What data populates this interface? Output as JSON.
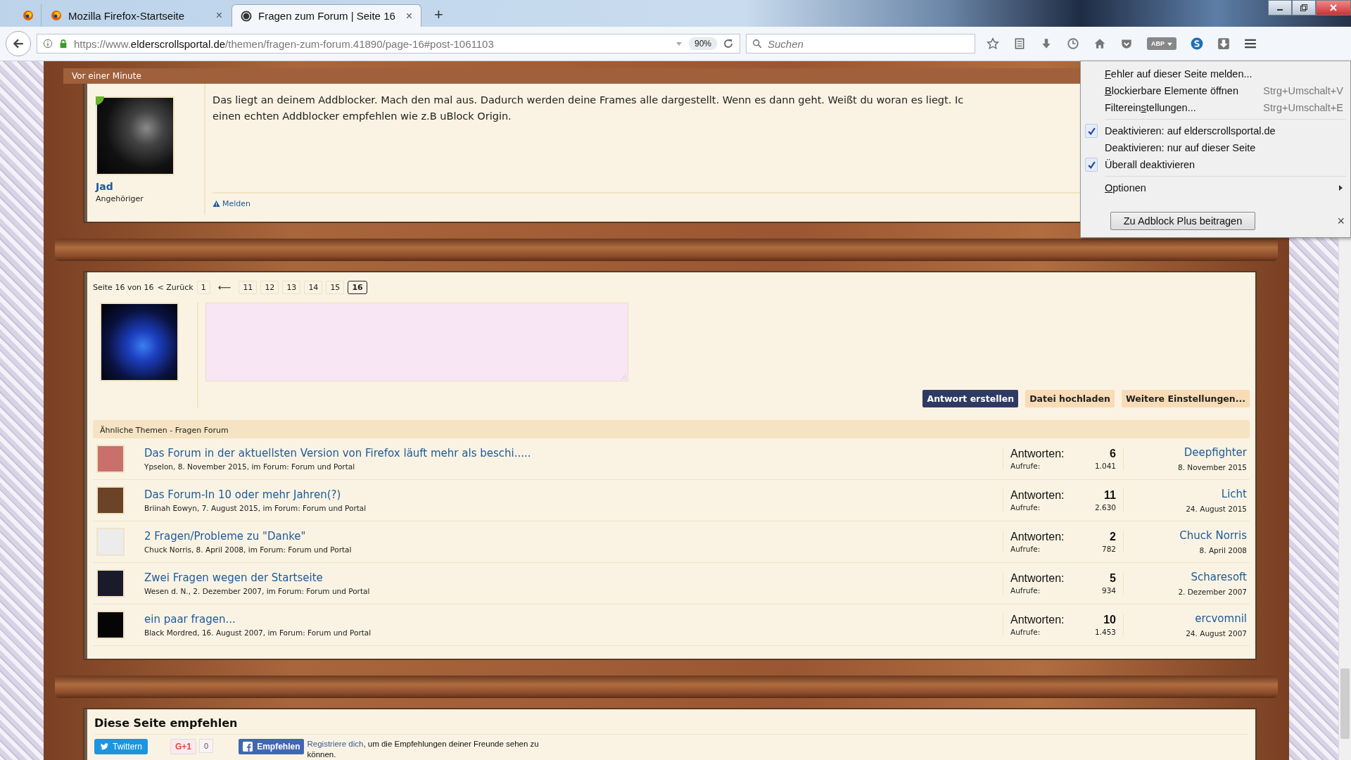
{
  "browser": {
    "pinned_tab": {
      "selected": false
    },
    "tabs": [
      {
        "title": "Mozilla Firefox-Startseite",
        "close": "×",
        "selected": false
      },
      {
        "title": "Fragen zum Forum | Seite 16",
        "close": "×",
        "selected": true
      }
    ],
    "new_tab": "+",
    "url": {
      "prefix": "https://www.",
      "domain": "elderscrollsportal.de",
      "path": "/themen/fragen-zum-forum.41890/page-16#post-1061103"
    },
    "zoom": "90%",
    "search": {
      "placeholder": "Suchen"
    },
    "adblock_badge": "ABP"
  },
  "post": {
    "time": "Vor einer Minute",
    "author": "Jad",
    "role": "Angehöriger",
    "online": true,
    "lines": [
      "Das liegt an deinem Addblocker. Mach den mal aus. Dadurch werden deine Frames alle dargestellt. Wenn es dann geht. Weißt du woran es liegt. Ic",
      "einen echten Addblocker empfehlen wie z.B uBlock Origin."
    ],
    "report": "Melden"
  },
  "pagination": {
    "label": "Seite 16 von 16",
    "prev": "< Zurück",
    "first": [
      {
        "label": "1",
        "selected": false
      }
    ],
    "skip": "⟵",
    "pages": [
      {
        "label": "11",
        "selected": false
      },
      {
        "label": "12",
        "selected": false
      },
      {
        "label": "13",
        "selected": false
      },
      {
        "label": "14",
        "selected": false
      },
      {
        "label": "15",
        "selected": false
      },
      {
        "label": "16",
        "selected": true
      }
    ]
  },
  "reply": {
    "buttons": [
      {
        "label": "Antwort erstellen",
        "kind": "primary"
      },
      {
        "label": "Datei hochladen",
        "kind": "secondary"
      },
      {
        "label": "Weitere Einstellungen...",
        "kind": "secondary"
      }
    ]
  },
  "similar": {
    "title": "Ähnliche Themen - Fragen Forum",
    "threads": [
      {
        "title": "Das Forum in der aktuellsten Version von Firefox läuft mehr als beschi.....",
        "meta": "Ypselon, 8. November 2015, im Forum: Forum und Portal",
        "replies_label": "Antworten:",
        "replies": "6",
        "views_label": "Aufrufe:",
        "views": "1.041",
        "last_user": "Deepfighter",
        "last_date": "8. November 2015",
        "color": "#c9706a"
      },
      {
        "title": "Das Forum-In 10 oder mehr Jahren(?)",
        "meta": "Briinah Eowyn, 7. August 2015, im Forum: Forum und Portal",
        "replies_label": "Antworten:",
        "replies": "11",
        "views_label": "Aufrufe:",
        "views": "2.630",
        "last_user": "Licht",
        "last_date": "24. August 2015",
        "color": "#6b4326"
      },
      {
        "title": "2 Fragen/Probleme zu \"Danke\"",
        "meta": "Chuck Norris, 8. April 2008, im Forum: Forum und Portal",
        "replies_label": "Antworten:",
        "replies": "2",
        "views_label": "Aufrufe:",
        "views": "782",
        "last_user": "Chuck Norris",
        "last_date": "8. April 2008",
        "color": "#ececec"
      },
      {
        "title": "Zwei Fragen wegen der Startseite",
        "meta": "Wesen d. N., 2. Dezember 2007, im Forum: Forum und Portal",
        "replies_label": "Antworten:",
        "replies": "5",
        "views_label": "Aufrufe:",
        "views": "934",
        "last_user": "Scharesoft",
        "last_date": "2. Dezember 2007",
        "color": "#1a1a2a"
      },
      {
        "title": "ein paar fragen...",
        "meta": "Black Mordred, 16. August 2007, im Forum: Forum und Portal",
        "replies_label": "Antworten:",
        "replies": "10",
        "views_label": "Aufrufe:",
        "views": "1.453",
        "last_user": "ercvomnil",
        "last_date": "24. August 2007",
        "color": "#050505"
      }
    ]
  },
  "recommend": {
    "title": "Diese Seite empfehlen",
    "tweet": "Twittern",
    "gplus": "G+1",
    "gplus_count": "0",
    "facebook": "Empfehlen",
    "register_link": "Registriere dich",
    "register_text": ", um die Empfehlungen deiner Freunde sehen zu können."
  },
  "menu": {
    "groups": [
      [
        {
          "parts": [
            {
              "text": "F",
              "underline": true
            },
            {
              "text": "ehler auf dieser Seite melden...",
              "underline": false
            }
          ],
          "checked": false,
          "submenu": false
        },
        {
          "parts": [
            {
              "text": "B",
              "underline": true
            },
            {
              "text": "lockierbare Elemente öffnen",
              "underline": false
            }
          ],
          "shortcut": "Strg+Umschalt+V",
          "checked": false,
          "submenu": false
        },
        {
          "parts": [
            {
              "text": "Filterein",
              "underline": false
            },
            {
              "text": "s",
              "underline": true
            },
            {
              "text": "tellungen...",
              "underline": false
            }
          ],
          "shortcut": "Strg+Umschalt+E",
          "checked": false,
          "submenu": false
        }
      ],
      [
        {
          "parts": [
            {
              "text": "Deaktivieren: auf elderscrollsportal.de",
              "underline": false
            }
          ],
          "checked": true,
          "submenu": false
        },
        {
          "parts": [
            {
              "text": "Deaktivieren: nur auf dieser Seite",
              "underline": false
            }
          ],
          "checked": false,
          "submenu": false
        },
        {
          "parts": [
            {
              "text": "Überall deaktivieren",
              "underline": false
            }
          ],
          "checked": true,
          "submenu": false
        }
      ],
      [
        {
          "parts": [
            {
              "text": "O",
              "underline": true
            },
            {
              "text": "ptionen",
              "underline": false
            }
          ],
          "checked": false,
          "submenu": true
        }
      ]
    ],
    "contribute": "Zu Adblock Plus beitragen",
    "close": "×"
  }
}
